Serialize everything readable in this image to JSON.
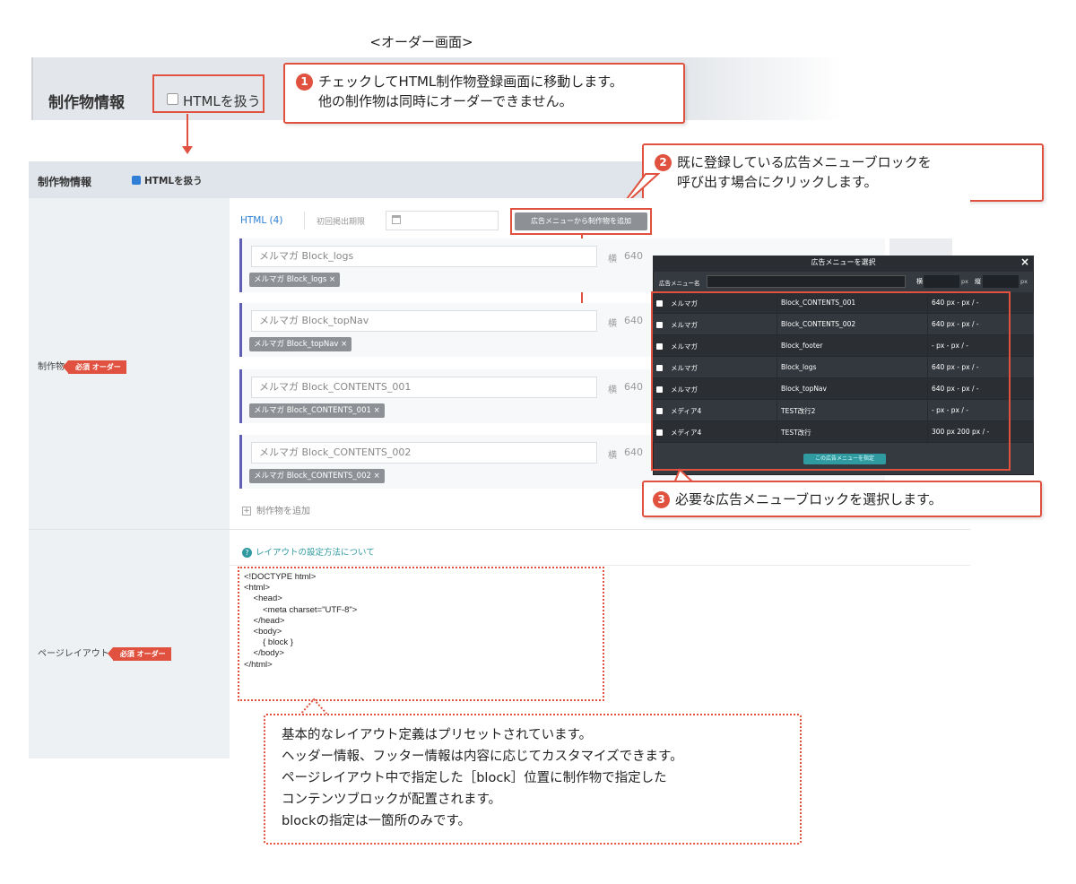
{
  "page_title": "<オーダー画面>",
  "top_section": {
    "title": "制作物情報",
    "checkbox_label": "HTMLを扱う"
  },
  "callouts": {
    "c1": {
      "number": "1",
      "line1": "チェックしてHTML制作物登録画面に移動します。",
      "line2": "他の制作物は同時にオーダーできません。"
    },
    "c2": {
      "number": "2",
      "line1": "既に登録している広告メニューブロックを",
      "line2": "呼び出す場合にクリックします。"
    },
    "c3": {
      "number": "3",
      "line1": "必要な広告メニューブロックを選択します。"
    },
    "c4": {
      "line1": "基本的なレイアウト定義はプリセットされています。",
      "line2": "ヘッダー情報、フッター情報は内容に応じてカスタマイズできます。",
      "line3": "ページレイアウト中で指定した［block］位置に制作物で指定した",
      "line4": "コンテンツブロックが配置されます。",
      "line5": "blockの指定は一箇所のみです。"
    }
  },
  "form": {
    "title": "制作物情報",
    "checkbox_label": "HTMLを扱う",
    "checkbox_checked": true,
    "products_label": "制作物",
    "required_badge": "必須 オーダー",
    "tab_html": "HTML (4)",
    "first_date_label": "初回掲出期限",
    "add_from_menu_button": "広告メニューから制作物を追加",
    "blocks": [
      {
        "placeholder": "メルマガ Block_logs",
        "tag": "メルマガ Block_logs",
        "width_label": "横",
        "width": "640"
      },
      {
        "placeholder": "メルマガ Block_topNav",
        "tag": "メルマガ Block_topNav",
        "width_label": "横",
        "width": "640"
      },
      {
        "placeholder": "メルマガ Block_CONTENTS_001",
        "tag": "メルマガ Block_CONTENTS_001",
        "width_label": "横",
        "width": "640"
      },
      {
        "placeholder": "メルマガ Block_CONTENTS_002",
        "tag": "メルマガ Block_CONTENTS_002",
        "width_label": "横",
        "width": "640"
      }
    ],
    "add_product": "制作物を追加",
    "layout_label": "ページレイアウト",
    "layout_required_badge": "必須 オーダー",
    "layout_help": "レイアウトの設定方法について",
    "layout_code": "<!DOCTYPE html>\n<html>\n    <head>\n        <meta charset=\"UTF-8\">\n    </head>\n    <body>\n        { block }\n    </body>\n</html>"
  },
  "modal": {
    "title": "広告メニューを選択",
    "close": "×",
    "search_label": "広告メニュー名",
    "w_label": "横",
    "h_label": "縦",
    "unit": "px",
    "rows": [
      {
        "media": "メルマガ",
        "name": "Block_CONTENTS_001",
        "size": "640 px - px",
        "mark": "/ -"
      },
      {
        "media": "メルマガ",
        "name": "Block_CONTENTS_002",
        "size": "640 px - px",
        "mark": "/ -"
      },
      {
        "media": "メルマガ",
        "name": "Block_footer",
        "size": "- px - px",
        "mark": "/ -"
      },
      {
        "media": "メルマガ",
        "name": "Block_logs",
        "size": "640 px - px",
        "mark": "/ -"
      },
      {
        "media": "メルマガ",
        "name": "Block_topNav",
        "size": "640 px - px",
        "mark": "/ -"
      },
      {
        "media": "メディア4",
        "name": "TEST改行2",
        "size": "- px - px",
        "mark": "/ -"
      },
      {
        "media": "メディア4",
        "name": "TEST改行",
        "size": "300 px 200 px",
        "mark": "/ -"
      }
    ],
    "submit": "この広告メニューを指定"
  },
  "colors": {
    "accent_red": "#e0523f",
    "link_blue": "#2f7fd6",
    "teal": "#2f9aa0",
    "modal_bg": "#353a40"
  }
}
